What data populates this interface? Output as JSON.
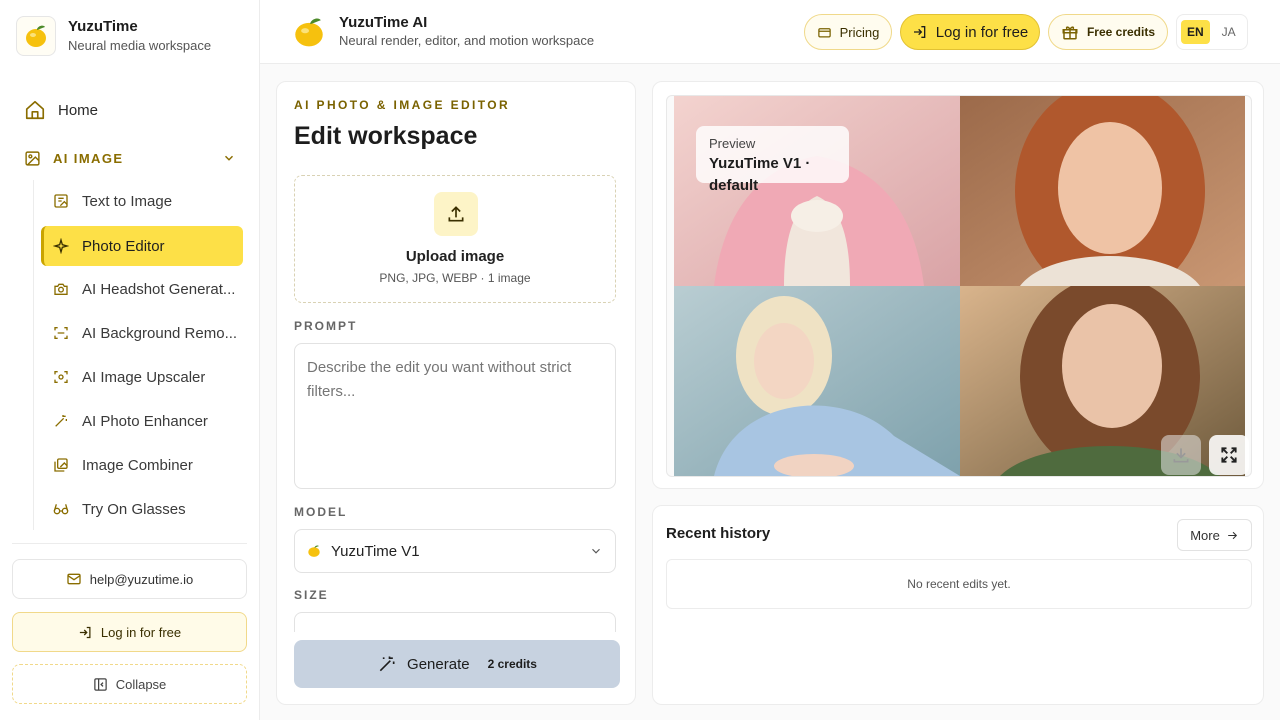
{
  "sidebar": {
    "brand_name": "YuzuTime",
    "brand_sub": "Neural media workspace",
    "home_label": "Home",
    "section_label": "AI IMAGE",
    "items": [
      {
        "label": "Text to Image",
        "icon": "image-text-icon"
      },
      {
        "label": "Photo Editor",
        "icon": "sparkles-icon",
        "active": true
      },
      {
        "label": "AI Headshot Generat...",
        "icon": "camera-icon"
      },
      {
        "label": "AI Background Remo...",
        "icon": "scan-icon"
      },
      {
        "label": "AI Image Upscaler",
        "icon": "upscale-icon"
      },
      {
        "label": "AI Photo Enhancer",
        "icon": "magic-wand-icon"
      },
      {
        "label": "Image Combiner",
        "icon": "images-icon"
      },
      {
        "label": "Try On Glasses",
        "icon": "glasses-icon"
      }
    ],
    "email": "help@yuzutime.io",
    "login_label": "Log in for free",
    "collapse_label": "Collapse"
  },
  "header": {
    "title": "YuzuTime AI",
    "subtitle": "Neural render, editor, and motion workspace",
    "pricing_label": "Pricing",
    "login_label": "Log in for free",
    "credits_label": "Free credits",
    "lang_active": "EN",
    "lang_other": "JA"
  },
  "editor": {
    "kicker": "AI PHOTO & IMAGE EDITOR",
    "title": "Edit workspace",
    "upload_title": "Upload image",
    "upload_sub": "PNG, JPG, WEBP · 1 image",
    "prompt_label": "PROMPT",
    "prompt_placeholder": "Describe the edit you want without strict filters...",
    "model_label": "MODEL",
    "model_value": "YuzuTime V1",
    "size_label": "SIZE",
    "generate_label": "Generate",
    "generate_credits": "2 credits"
  },
  "preview": {
    "tag_label": "Preview",
    "tag_model": "YuzuTime V1 · default"
  },
  "history": {
    "title": "Recent history",
    "more_label": "More",
    "empty_text": "No recent edits yet."
  },
  "colors": {
    "accent": "#fde047",
    "accent_text": "#8a6d00",
    "generate_disabled": "#c7d2e0"
  }
}
